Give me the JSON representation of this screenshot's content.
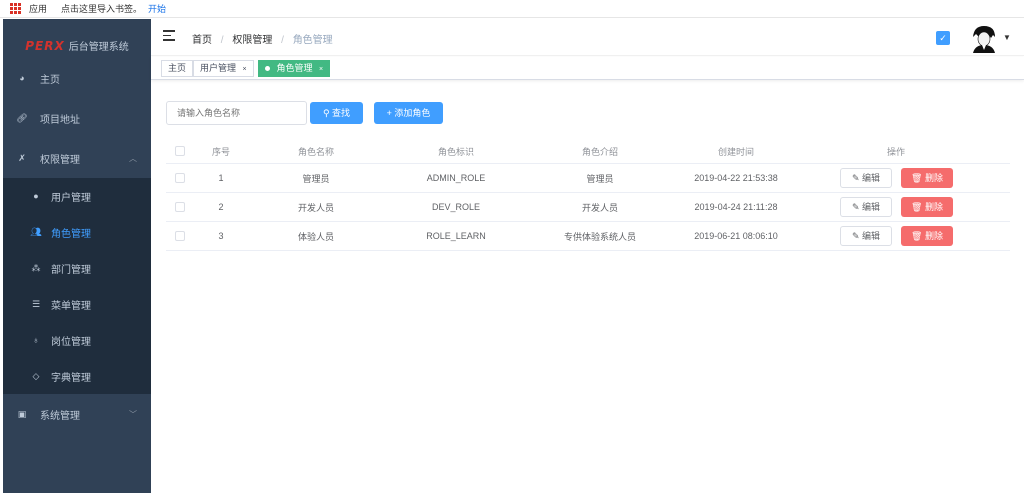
{
  "bookmarks": {
    "apps_label": "应用",
    "import_hint": "点击这里导入书签。",
    "start_link": "开始"
  },
  "sidebar": {
    "logo_mark": "PERX",
    "logo_title": "后台管理系统",
    "items": [
      {
        "label": "主页",
        "icon": "dashboard-icon"
      },
      {
        "label": "项目地址",
        "icon": "link-icon"
      },
      {
        "label": "权限管理",
        "icon": "permission-icon",
        "expanded": true
      },
      {
        "label": "系统管理",
        "icon": "monitor-icon",
        "expanded": false
      }
    ],
    "permission_submenu": [
      {
        "label": "用户管理",
        "icon": "user-icon",
        "active": false
      },
      {
        "label": "角色管理",
        "icon": "peoples-icon",
        "active": true
      },
      {
        "label": "部门管理",
        "icon": "tree-icon",
        "active": false
      },
      {
        "label": "菜单管理",
        "icon": "menu-list-icon",
        "active": false
      },
      {
        "label": "岗位管理",
        "icon": "post-icon",
        "active": false
      },
      {
        "label": "字典管理",
        "icon": "tag-icon",
        "active": false
      }
    ]
  },
  "navbar": {
    "breadcrumb": [
      "首页",
      "权限管理",
      "角色管理"
    ]
  },
  "tags": [
    {
      "label": "主页",
      "active": false,
      "closable": false
    },
    {
      "label": "用户管理",
      "active": false,
      "closable": true
    },
    {
      "label": "角色管理",
      "active": true,
      "closable": true
    }
  ],
  "filter": {
    "search_placeholder": "请输入角色名称",
    "search_button": "查找",
    "add_button": "添加角色"
  },
  "table": {
    "columns": [
      "序号",
      "角色名称",
      "角色标识",
      "角色介绍",
      "创建时间",
      "操作"
    ],
    "rows": [
      {
        "index": "1",
        "name": "管理员",
        "key": "ADMIN_ROLE",
        "desc": "管理员",
        "created": "2019-04-22 21:53:38"
      },
      {
        "index": "2",
        "name": "开发人员",
        "key": "DEV_ROLE",
        "desc": "开发人员",
        "created": "2019-04-24 21:11:28"
      },
      {
        "index": "3",
        "name": "体验人员",
        "key": "ROLE_LEARN",
        "desc": "专供体验系统人员",
        "created": "2019-06-21 08:06:10"
      }
    ],
    "edit_label": "编辑",
    "delete_label": "删除"
  },
  "colors": {
    "sidebar_bg": "#304156",
    "submenu_bg": "#1f2d3d",
    "primary": "#409eff",
    "active_tag": "#42b983",
    "danger": "#f56c6c"
  }
}
